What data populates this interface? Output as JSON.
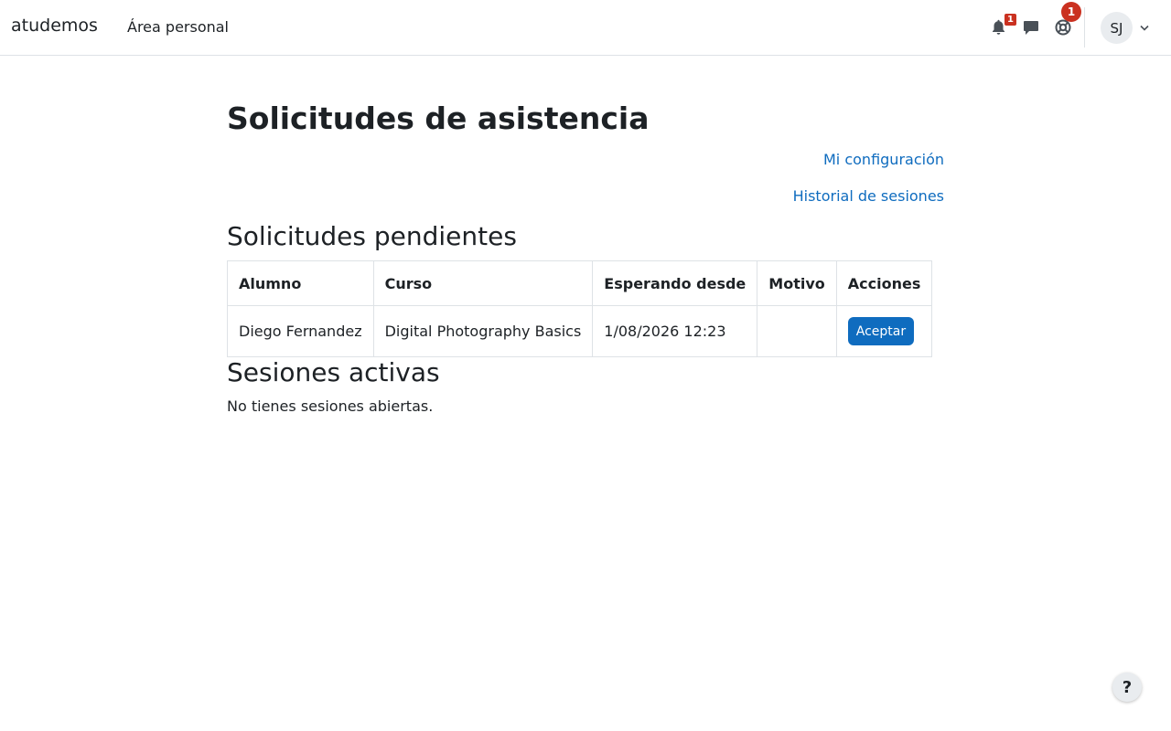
{
  "navbar": {
    "brand": "atudemos",
    "links": [
      {
        "label": "Área personal"
      }
    ],
    "notifications": {
      "icon": "bell-icon",
      "count": "1"
    },
    "messages": {
      "icon": "chat-icon"
    },
    "support": {
      "icon": "lifebuoy-icon",
      "count": "1"
    },
    "user": {
      "initials": "SJ",
      "menu_icon": "chevron-down-icon"
    }
  },
  "page": {
    "title": "Solicitudes de asistencia",
    "links": {
      "config": "Mi configuración",
      "history": "Historial de sesiones"
    }
  },
  "pending": {
    "title": "Solicitudes pendientes",
    "columns": [
      "Alumno",
      "Curso",
      "Esperando desde",
      "Motivo",
      "Acciones"
    ],
    "rows": [
      {
        "alumno": "Diego Fernandez",
        "curso": "Digital Photography Basics",
        "desde": "1/08/2026 12:23",
        "motivo": "",
        "action_label": "Aceptar"
      }
    ]
  },
  "active": {
    "title": "Sesiones activas",
    "empty_message": "No tienes sesiones abiertas."
  },
  "help_button": {
    "label": "?"
  },
  "colors": {
    "link": "#0f6cbf",
    "primary_button": "#0f6cbf",
    "badge": "#ca3120",
    "border": "#dee2e6",
    "text": "#1d2125"
  }
}
